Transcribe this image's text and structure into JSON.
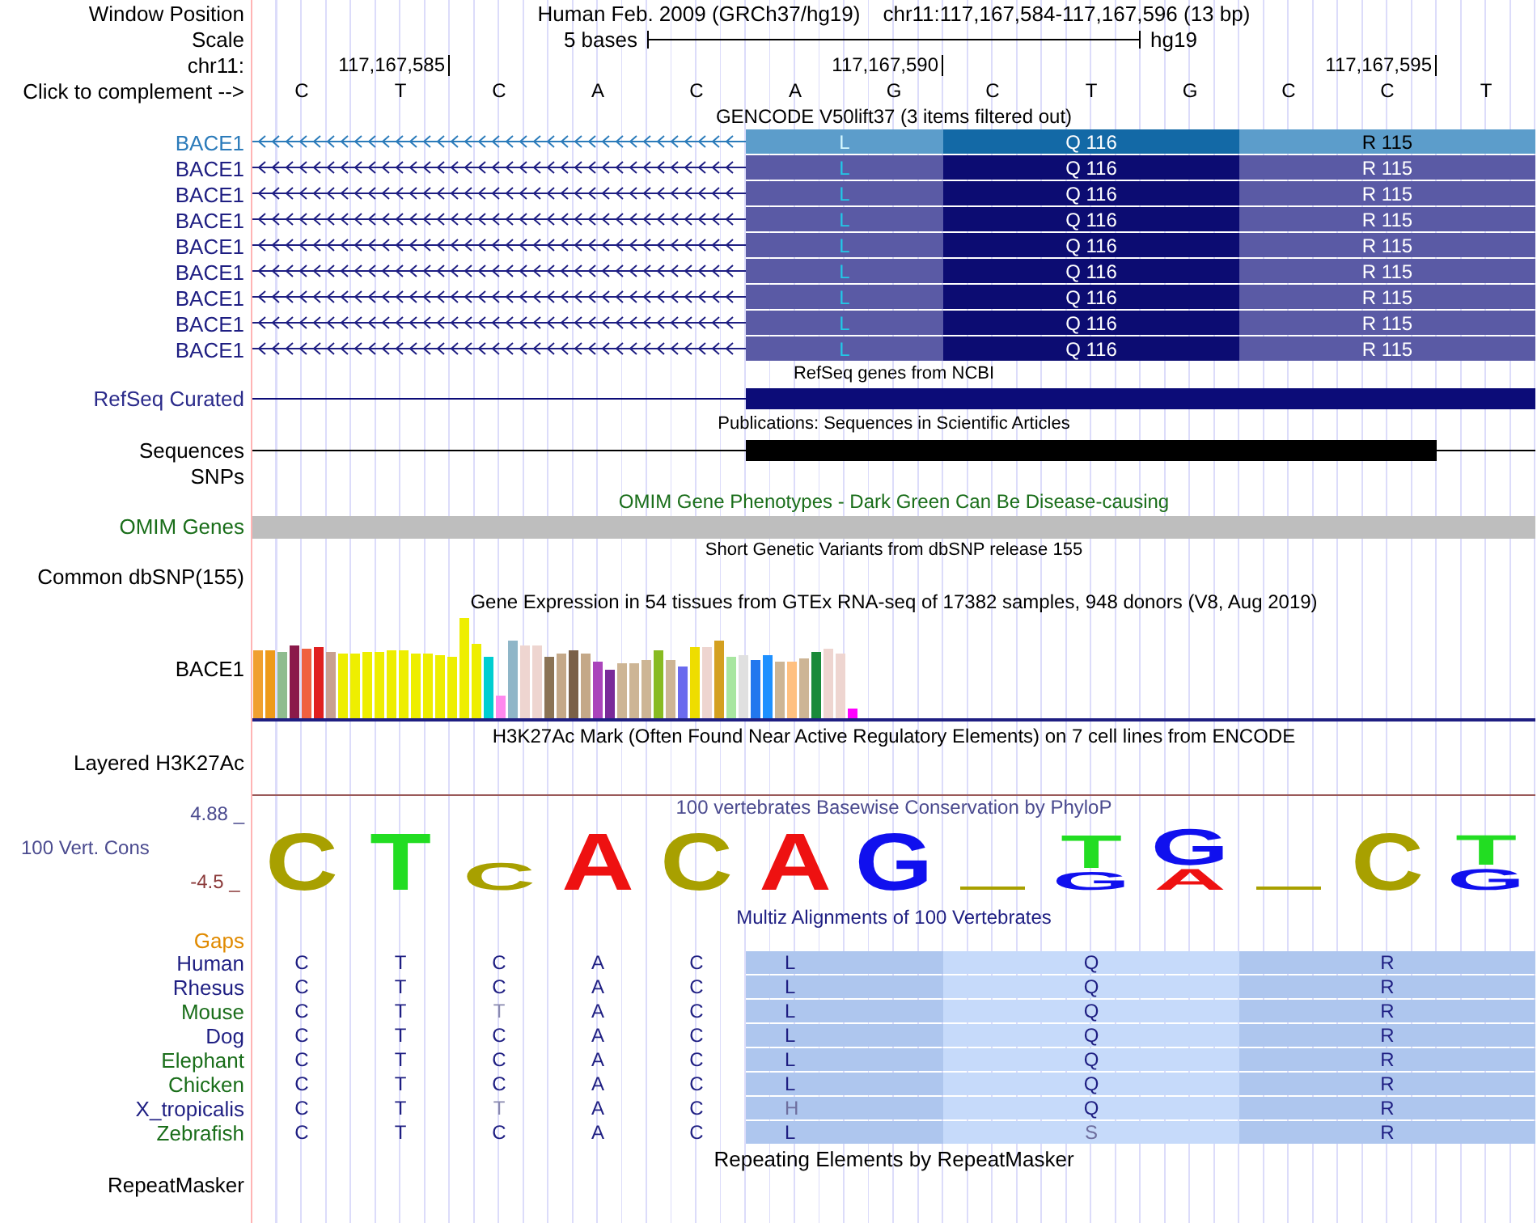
{
  "header": {
    "position_label": "Window Position",
    "assembly": "Human Feb. 2009 (GRCh37/hg19)",
    "position": "chr11:117,167,584-117,167,596 (13 bp)",
    "scale_label": "Scale",
    "scale_text": "5 bases",
    "scale_db": "hg19",
    "chrom_label": "chr11:",
    "ticks": [
      "117,167,585",
      "117,167,590",
      "117,167,595"
    ],
    "complement_label": "Click to complement -->",
    "bases": [
      "C",
      "T",
      "C",
      "A",
      "C",
      "A",
      "G",
      "C",
      "T",
      "G",
      "C",
      "C",
      "T"
    ]
  },
  "gencode": {
    "title": "GENCODE V50lift37 (3 items filtered out)",
    "rows": [
      {
        "name": "BACE1",
        "kind": "canonical",
        "codons": [
          "L",
          "Q 116",
          "R 115"
        ]
      },
      {
        "name": "BACE1",
        "kind": "alternative",
        "codons": [
          "L",
          "Q 116",
          "R 115"
        ]
      },
      {
        "name": "BACE1",
        "kind": "alternative",
        "codons": [
          "L",
          "Q 116",
          "R 115"
        ]
      },
      {
        "name": "BACE1",
        "kind": "alternative",
        "codons": [
          "L",
          "Q 116",
          "R 115"
        ]
      },
      {
        "name": "BACE1",
        "kind": "alternative",
        "codons": [
          "L",
          "Q 116",
          "R 115"
        ]
      },
      {
        "name": "BACE1",
        "kind": "alternative",
        "codons": [
          "L",
          "Q 116",
          "R 115"
        ]
      },
      {
        "name": "BACE1",
        "kind": "alternative",
        "codons": [
          "L",
          "Q 116",
          "R 115"
        ]
      },
      {
        "name": "BACE1",
        "kind": "alternative",
        "codons": [
          "L",
          "Q 116",
          "R 115"
        ]
      },
      {
        "name": "BACE1",
        "kind": "alternative",
        "codons": [
          "L",
          "Q 116",
          "R 115"
        ]
      }
    ]
  },
  "refseq": {
    "title": "RefSeq genes from NCBI",
    "label": "RefSeq Curated"
  },
  "publications": {
    "title": "Publications: Sequences in Scientific Articles",
    "label": "Sequences"
  },
  "snps": {
    "label": "SNPs"
  },
  "omim": {
    "title": "OMIM Gene Phenotypes - Dark Green Can Be Disease-causing",
    "label": "OMIM Genes"
  },
  "dbsnp": {
    "title": "Short Genetic Variants from dbSNP release 155",
    "label": "Common dbSNP(155)"
  },
  "gtex": {
    "title": "Gene Expression in 54 tissues from GTEx RNA-seq of 17382 samples, 948 donors (V8, Aug 2019)",
    "label": "BACE1"
  },
  "h3k27ac": {
    "title": "H3K27Ac Mark (Often Found Near Active Regulatory Elements) on 7 cell lines from ENCODE",
    "label": "Layered H3K27Ac"
  },
  "conservation": {
    "title": "100 vertebrates Basewise Conservation by PhyloP",
    "label": "100 Vert. Cons",
    "max": "4.88 _",
    "min": "-4.5 _",
    "logo": [
      {
        "kind": "letter",
        "letter": "C",
        "color": "#a8a000"
      },
      {
        "kind": "letter",
        "letter": "T",
        "color": "#22dd22"
      },
      {
        "kind": "letter",
        "letter": "C",
        "color": "#a8a000"
      },
      {
        "kind": "letter",
        "letter": "A",
        "color": "#ee1111"
      },
      {
        "kind": "letter",
        "letter": "C",
        "color": "#a8a000"
      },
      {
        "kind": "letter",
        "letter": "A",
        "color": "#ee1111"
      },
      {
        "kind": "letter",
        "letter": "G",
        "color": "#1010ee"
      },
      {
        "kind": "dash",
        "color": "#a8a000"
      },
      {
        "kind": "letter",
        "letter": "T",
        "color": "#22dd22",
        "sub": {
          "letter": "G",
          "color": "#1010ee"
        }
      },
      {
        "kind": "letter",
        "letter": "G",
        "color": "#1010ee",
        "sub": {
          "letter": "A",
          "color": "#ee1111"
        }
      },
      {
        "kind": "dash",
        "color": "#a8a000"
      },
      {
        "kind": "letter",
        "letter": "C",
        "color": "#a8a000"
      },
      {
        "kind": "letter",
        "letter": "T",
        "color": "#22dd22",
        "sub": {
          "letter": "G",
          "color": "#1010ee"
        }
      }
    ]
  },
  "multiz": {
    "title": "Multiz Alignments of 100 Vertebrates",
    "gaps_label": "Gaps",
    "species": [
      {
        "name": "Human",
        "color": "#1e1e82",
        "bases": [
          {
            "text": "C",
            "faded": false
          },
          {
            "text": "T",
            "faded": false
          },
          {
            "text": "C",
            "faded": false
          },
          {
            "text": "A",
            "faded": false
          },
          {
            "text": "C",
            "faded": false
          }
        ],
        "aa": [
          {
            "text": "L",
            "faded": false
          },
          {
            "text": "Q",
            "faded": false
          },
          {
            "text": "R",
            "faded": false
          }
        ]
      },
      {
        "name": "Rhesus",
        "color": "#1e1e82",
        "bases": [
          {
            "text": "C",
            "faded": false
          },
          {
            "text": "T",
            "faded": false
          },
          {
            "text": "C",
            "faded": false
          },
          {
            "text": "A",
            "faded": false
          },
          {
            "text": "C",
            "faded": false
          }
        ],
        "aa": [
          {
            "text": "L",
            "faded": false
          },
          {
            "text": "Q",
            "faded": false
          },
          {
            "text": "R",
            "faded": false
          }
        ]
      },
      {
        "name": "Mouse",
        "color": "#1a6e1a",
        "bases": [
          {
            "text": "C",
            "faded": false
          },
          {
            "text": "T",
            "faded": false
          },
          {
            "text": "T",
            "faded": true
          },
          {
            "text": "A",
            "faded": false
          },
          {
            "text": "C",
            "faded": false
          }
        ],
        "aa": [
          {
            "text": "L",
            "faded": false
          },
          {
            "text": "Q",
            "faded": false
          },
          {
            "text": "R",
            "faded": false
          }
        ]
      },
      {
        "name": "Dog",
        "color": "#1e1e82",
        "bases": [
          {
            "text": "C",
            "faded": false
          },
          {
            "text": "T",
            "faded": false
          },
          {
            "text": "C",
            "faded": false
          },
          {
            "text": "A",
            "faded": false
          },
          {
            "text": "C",
            "faded": false
          }
        ],
        "aa": [
          {
            "text": "L",
            "faded": false
          },
          {
            "text": "Q",
            "faded": false
          },
          {
            "text": "R",
            "faded": false
          }
        ]
      },
      {
        "name": "Elephant",
        "color": "#1a6e1a",
        "bases": [
          {
            "text": "C",
            "faded": false
          },
          {
            "text": "T",
            "faded": false
          },
          {
            "text": "C",
            "faded": false
          },
          {
            "text": "A",
            "faded": false
          },
          {
            "text": "C",
            "faded": false
          }
        ],
        "aa": [
          {
            "text": "L",
            "faded": false
          },
          {
            "text": "Q",
            "faded": false
          },
          {
            "text": "R",
            "faded": false
          }
        ]
      },
      {
        "name": "Chicken",
        "color": "#1a6e1a",
        "bases": [
          {
            "text": "C",
            "faded": false
          },
          {
            "text": "T",
            "faded": false
          },
          {
            "text": "C",
            "faded": false
          },
          {
            "text": "A",
            "faded": false
          },
          {
            "text": "C",
            "faded": false
          }
        ],
        "aa": [
          {
            "text": "L",
            "faded": false
          },
          {
            "text": "Q",
            "faded": false
          },
          {
            "text": "R",
            "faded": false
          }
        ]
      },
      {
        "name": "X_tropicalis",
        "color": "#1e1e82",
        "bases": [
          {
            "text": "C",
            "faded": false
          },
          {
            "text": "T",
            "faded": false
          },
          {
            "text": "T",
            "faded": true
          },
          {
            "text": "A",
            "faded": false
          },
          {
            "text": "C",
            "faded": false
          }
        ],
        "aa": [
          {
            "text": "H",
            "faded": true
          },
          {
            "text": "Q",
            "faded": false
          },
          {
            "text": "R",
            "faded": false
          }
        ]
      },
      {
        "name": "Zebrafish",
        "color": "#1a6e1a",
        "bases": [
          {
            "text": "C",
            "faded": false
          },
          {
            "text": "T",
            "faded": false
          },
          {
            "text": "C",
            "faded": false
          },
          {
            "text": "A",
            "faded": false
          },
          {
            "text": "C",
            "faded": false
          }
        ],
        "aa": [
          {
            "text": "L",
            "faded": false
          },
          {
            "text": "S",
            "faded": true
          },
          {
            "text": "R",
            "faded": false
          }
        ]
      }
    ]
  },
  "repeatmasker": {
    "title": "Repeating Elements by RepeatMasker",
    "label": "RepeatMasker"
  }
}
